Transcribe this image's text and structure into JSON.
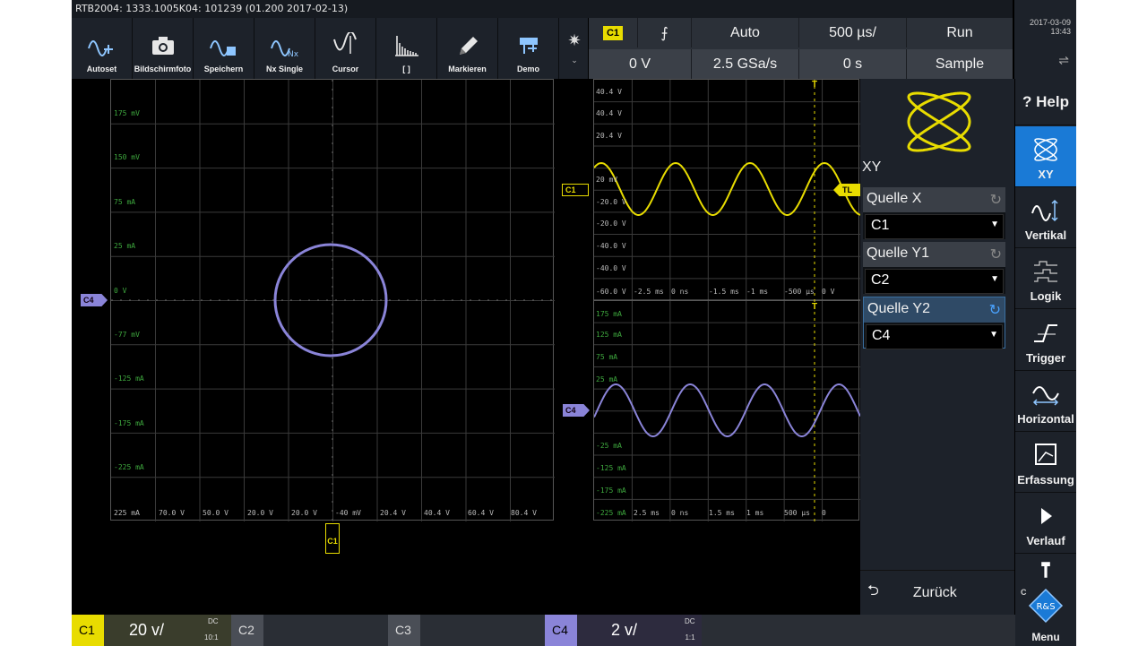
{
  "title": "RTB2004: 1333.1005K04: 101239 (01.200 2017-02-13)",
  "toolbar": [
    {
      "label": "Autoset",
      "icon": "autoset-icon"
    },
    {
      "label": "Bildschirmfoto",
      "icon": "camera-icon"
    },
    {
      "label": "Speichern",
      "icon": "save-waveform-icon"
    },
    {
      "label": "Nx Single",
      "icon": "nx-single-icon"
    },
    {
      "label": "Cursor",
      "icon": "cursor-icon"
    },
    {
      "label": "[ ]",
      "icon": "histogram-icon"
    },
    {
      "label": "Markieren",
      "icon": "pencil-icon"
    },
    {
      "label": "Demo",
      "icon": "demo-icon"
    }
  ],
  "gear_caret": "⌄",
  "info": {
    "channel_chip": "C1",
    "slope": "⨍",
    "trigger_mode": "Auto",
    "timebase": "500 µs/",
    "run_state": "Run",
    "trigger_level": "0 V",
    "sample_rate": "2.5 GSa/s",
    "time_offset": "0 s",
    "acq_mode": "Sample"
  },
  "datetime": {
    "date": "2017-03-09",
    "time": "13:43",
    "usb": "⇌"
  },
  "xy_plot": {
    "y_labels": [
      "175 mV",
      "150 mV",
      "75 mA",
      "25 mA",
      "0 V",
      "-77 mV",
      "-125 mA",
      "-175 mA",
      "-225 mA"
    ],
    "x_labels": [
      "225 mA",
      "70.0 V",
      "50.0 V",
      "20.0 V",
      "20.0 V",
      "-40 mV",
      "20.4 V",
      "40.4 V",
      "60.4 V",
      "80.4 V"
    ],
    "left_marker": "C4",
    "bottom_marker": "C1",
    "circle_color": "#8a84d8"
  },
  "yt_plot": {
    "upper_y_labels": [
      "40.4 V",
      "40.4 V",
      "20.4 V",
      "20 mV",
      "-20.0 V",
      "-20.0 V",
      "-40.0 V",
      "-40.0 V"
    ],
    "mid_labels": [
      "-60.0 V",
      "-2.5 ms",
      "0 ns",
      "-1.5 ms",
      "-1 ms",
      "-500 µs",
      "0 V"
    ],
    "lower_y_labels": [
      "175 mA",
      "125 mA",
      "75 mA",
      "25 mA",
      "-25 mA",
      "-125 mA",
      "-175 mA",
      "-225 mA"
    ],
    "bottom_labels": [
      "225 mA",
      "2.5 ms",
      "0 ns",
      "1.5 ms",
      "1 ms",
      "500 µs",
      "0"
    ],
    "c1_marker": "C1",
    "tl_marker": "TL",
    "c4_marker": "C4",
    "trigger_glyph": "T",
    "c1_color": "#e8dc00",
    "c4_color": "#8a84d8"
  },
  "side": {
    "title": "XY",
    "sources": [
      {
        "heading": "Quelle X",
        "value": "C1"
      },
      {
        "heading": "Quelle Y1",
        "value": "C2"
      },
      {
        "heading": "Quelle Y2",
        "value": "C4"
      }
    ],
    "back_arrow": "⮌",
    "back": "Zurück"
  },
  "menu": {
    "help": "? Help",
    "items": [
      "XY",
      "Vertikal",
      "Logik",
      "Trigger",
      "Horizontal",
      "Erfassung",
      "Verlauf"
    ],
    "last_partial": "C",
    "menu_label": "Menu",
    "brand": "R&S"
  },
  "channels": [
    {
      "tag": "C1",
      "scale": "20 v/",
      "coupling": "DC",
      "probe": "10:1",
      "color": "#e8dc00"
    },
    {
      "tag": "C2",
      "scale": "",
      "coupling": "",
      "probe": "",
      "color": "#5a5e66"
    },
    {
      "tag": "C3",
      "scale": "",
      "coupling": "",
      "probe": "",
      "color": "#5a5e66"
    },
    {
      "tag": "C4",
      "scale": "2 v/",
      "coupling": "DC",
      "probe": "1:1",
      "color": "#8a84d8"
    }
  ]
}
